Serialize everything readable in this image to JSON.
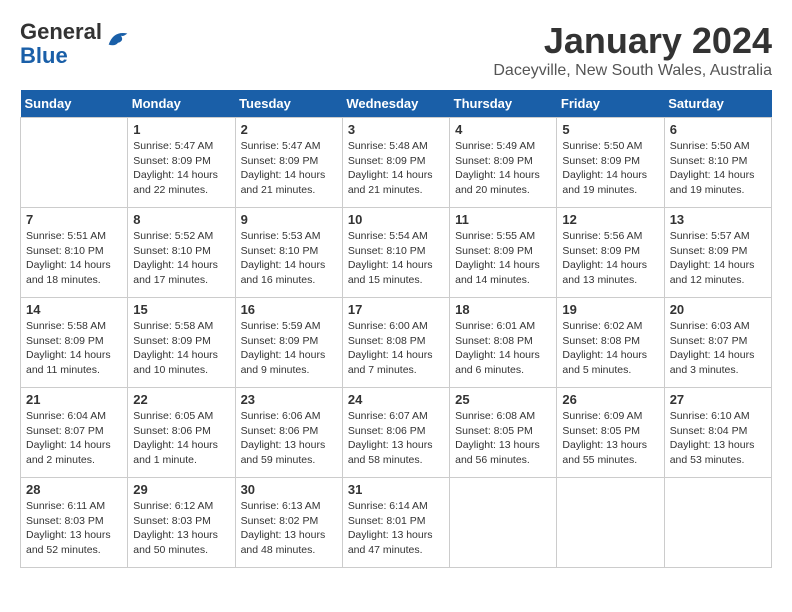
{
  "header": {
    "logo_line1": "General",
    "logo_line2": "Blue",
    "month_title": "January 2024",
    "subtitle": "Daceyville, New South Wales, Australia"
  },
  "days_of_week": [
    "Sunday",
    "Monday",
    "Tuesday",
    "Wednesday",
    "Thursday",
    "Friday",
    "Saturday"
  ],
  "weeks": [
    [
      {
        "day": "",
        "info": ""
      },
      {
        "day": "1",
        "info": "Sunrise: 5:47 AM\nSunset: 8:09 PM\nDaylight: 14 hours\nand 22 minutes."
      },
      {
        "day": "2",
        "info": "Sunrise: 5:47 AM\nSunset: 8:09 PM\nDaylight: 14 hours\nand 21 minutes."
      },
      {
        "day": "3",
        "info": "Sunrise: 5:48 AM\nSunset: 8:09 PM\nDaylight: 14 hours\nand 21 minutes."
      },
      {
        "day": "4",
        "info": "Sunrise: 5:49 AM\nSunset: 8:09 PM\nDaylight: 14 hours\nand 20 minutes."
      },
      {
        "day": "5",
        "info": "Sunrise: 5:50 AM\nSunset: 8:09 PM\nDaylight: 14 hours\nand 19 minutes."
      },
      {
        "day": "6",
        "info": "Sunrise: 5:50 AM\nSunset: 8:10 PM\nDaylight: 14 hours\nand 19 minutes."
      }
    ],
    [
      {
        "day": "7",
        "info": "Sunrise: 5:51 AM\nSunset: 8:10 PM\nDaylight: 14 hours\nand 18 minutes."
      },
      {
        "day": "8",
        "info": "Sunrise: 5:52 AM\nSunset: 8:10 PM\nDaylight: 14 hours\nand 17 minutes."
      },
      {
        "day": "9",
        "info": "Sunrise: 5:53 AM\nSunset: 8:10 PM\nDaylight: 14 hours\nand 16 minutes."
      },
      {
        "day": "10",
        "info": "Sunrise: 5:54 AM\nSunset: 8:10 PM\nDaylight: 14 hours\nand 15 minutes."
      },
      {
        "day": "11",
        "info": "Sunrise: 5:55 AM\nSunset: 8:09 PM\nDaylight: 14 hours\nand 14 minutes."
      },
      {
        "day": "12",
        "info": "Sunrise: 5:56 AM\nSunset: 8:09 PM\nDaylight: 14 hours\nand 13 minutes."
      },
      {
        "day": "13",
        "info": "Sunrise: 5:57 AM\nSunset: 8:09 PM\nDaylight: 14 hours\nand 12 minutes."
      }
    ],
    [
      {
        "day": "14",
        "info": "Sunrise: 5:58 AM\nSunset: 8:09 PM\nDaylight: 14 hours\nand 11 minutes."
      },
      {
        "day": "15",
        "info": "Sunrise: 5:58 AM\nSunset: 8:09 PM\nDaylight: 14 hours\nand 10 minutes."
      },
      {
        "day": "16",
        "info": "Sunrise: 5:59 AM\nSunset: 8:09 PM\nDaylight: 14 hours\nand 9 minutes."
      },
      {
        "day": "17",
        "info": "Sunrise: 6:00 AM\nSunset: 8:08 PM\nDaylight: 14 hours\nand 7 minutes."
      },
      {
        "day": "18",
        "info": "Sunrise: 6:01 AM\nSunset: 8:08 PM\nDaylight: 14 hours\nand 6 minutes."
      },
      {
        "day": "19",
        "info": "Sunrise: 6:02 AM\nSunset: 8:08 PM\nDaylight: 14 hours\nand 5 minutes."
      },
      {
        "day": "20",
        "info": "Sunrise: 6:03 AM\nSunset: 8:07 PM\nDaylight: 14 hours\nand 3 minutes."
      }
    ],
    [
      {
        "day": "21",
        "info": "Sunrise: 6:04 AM\nSunset: 8:07 PM\nDaylight: 14 hours\nand 2 minutes."
      },
      {
        "day": "22",
        "info": "Sunrise: 6:05 AM\nSunset: 8:06 PM\nDaylight: 14 hours\nand 1 minute."
      },
      {
        "day": "23",
        "info": "Sunrise: 6:06 AM\nSunset: 8:06 PM\nDaylight: 13 hours\nand 59 minutes."
      },
      {
        "day": "24",
        "info": "Sunrise: 6:07 AM\nSunset: 8:06 PM\nDaylight: 13 hours\nand 58 minutes."
      },
      {
        "day": "25",
        "info": "Sunrise: 6:08 AM\nSunset: 8:05 PM\nDaylight: 13 hours\nand 56 minutes."
      },
      {
        "day": "26",
        "info": "Sunrise: 6:09 AM\nSunset: 8:05 PM\nDaylight: 13 hours\nand 55 minutes."
      },
      {
        "day": "27",
        "info": "Sunrise: 6:10 AM\nSunset: 8:04 PM\nDaylight: 13 hours\nand 53 minutes."
      }
    ],
    [
      {
        "day": "28",
        "info": "Sunrise: 6:11 AM\nSunset: 8:03 PM\nDaylight: 13 hours\nand 52 minutes."
      },
      {
        "day": "29",
        "info": "Sunrise: 6:12 AM\nSunset: 8:03 PM\nDaylight: 13 hours\nand 50 minutes."
      },
      {
        "day": "30",
        "info": "Sunrise: 6:13 AM\nSunset: 8:02 PM\nDaylight: 13 hours\nand 48 minutes."
      },
      {
        "day": "31",
        "info": "Sunrise: 6:14 AM\nSunset: 8:01 PM\nDaylight: 13 hours\nand 47 minutes."
      },
      {
        "day": "",
        "info": ""
      },
      {
        "day": "",
        "info": ""
      },
      {
        "day": "",
        "info": ""
      }
    ]
  ]
}
